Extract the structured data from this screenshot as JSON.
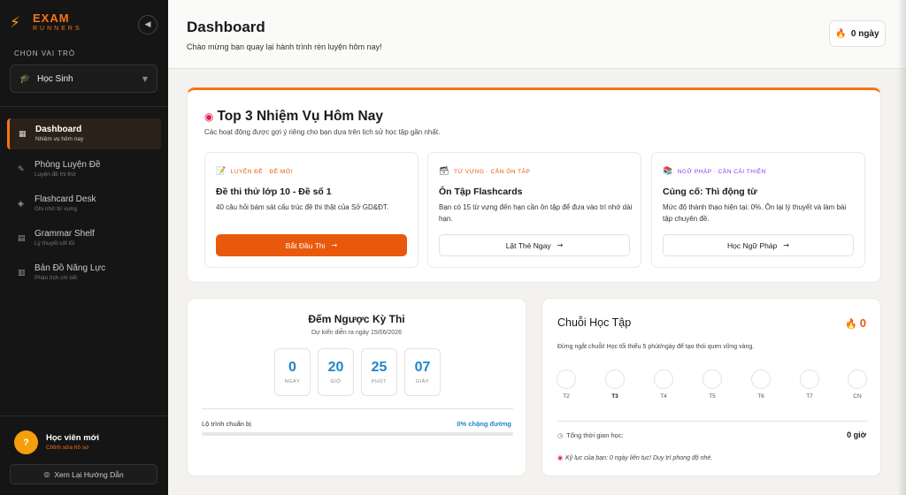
{
  "brand": {
    "name": "EXAM",
    "tagline": "RUNNERS"
  },
  "role": {
    "label": "CHỌN VAI TRÒ",
    "selected": "Học Sinh"
  },
  "nav": [
    {
      "title": "Dashboard",
      "sub": "Nhiệm vụ hôm nay"
    },
    {
      "title": "Phòng Luyện Đề",
      "sub": "Luyện đề thi thử"
    },
    {
      "title": "Flashcard Desk",
      "sub": "Ghi nhớ từ vựng"
    },
    {
      "title": "Grammar Shelf",
      "sub": "Lý thuyết cốt lõi"
    },
    {
      "title": "Bản Đồ Năng Lực",
      "sub": "Phân tích chi tiết"
    }
  ],
  "user": {
    "initial": "?",
    "name": "Học viên mới",
    "edit": "Chỉnh sửa hồ sơ"
  },
  "guide_button": "Xem Lại Hướng Dẫn",
  "header": {
    "title": "Dashboard",
    "subtitle": "Chào mừng bạn quay lại hành trình rèn luyện hôm nay!",
    "streak": "0 ngày"
  },
  "missions": {
    "title": "Top 3 Nhiệm Vụ Hôm Nay",
    "subtitle": "Các hoạt động được gợi ý riêng cho bạn dựa trên lịch sử học tập gần nhất.",
    "tasks": [
      {
        "tag": "LUYỆN ĐỀ · ĐỀ MỚI",
        "tag_color": "#ea580c",
        "icon": "memo-icon",
        "name": "Đề thi thử lớp 10 - Đề số 1",
        "desc": "40 câu hỏi bám sát cấu trúc đề thi thật của Sở GD&ĐT.",
        "button": "Bắt Đầu Thi"
      },
      {
        "tag": "TỪ VỰNG · CẦN ÔN TẬP",
        "tag_color": "#ea580c",
        "icon": "card-box-icon",
        "name": "Ôn Tập Flashcards",
        "desc": "Bạn có 15 từ vựng đến hạn cần ôn tập để đưa vào trí nhớ dài hạn.",
        "button": "Lật Thẻ Ngay"
      },
      {
        "tag": "NGỮ PHÁP · CẦN CẢI THIỆN",
        "tag_color": "#9333ea",
        "icon": "books-icon",
        "name": "Củng cố: Thì động từ",
        "desc": "Mức độ thành thạo hiện tại: 0%. Ôn lại lý thuyết và làm bài tập chuyên đề.",
        "button": "Học Ngữ Pháp"
      }
    ]
  },
  "countdown": {
    "title": "Đếm Ngược Kỳ Thi",
    "subtitle": "Dự kiến diễn ra ngày 15/06/2026",
    "units": [
      {
        "value": "0",
        "label": "NGÀY"
      },
      {
        "value": "20",
        "label": "GIỜ"
      },
      {
        "value": "25",
        "label": "PHÚT"
      },
      {
        "value": "07",
        "label": "GIÂY"
      }
    ],
    "progress_label": "Lộ trình chuẩn bị",
    "progress_text": "0% chặng đường",
    "progress_fraction": 0
  },
  "streak": {
    "title": "Chuỗi Học Tập",
    "count": "0",
    "subtitle": "Đừng ngắt chuỗi! Học tối thiểu 5 phút/ngày để tạo thói quen vững vàng.",
    "days": [
      {
        "label": "T2",
        "today": false
      },
      {
        "label": "T3",
        "today": true
      },
      {
        "label": "T4",
        "today": false
      },
      {
        "label": "T5",
        "today": false
      },
      {
        "label": "T6",
        "today": false
      },
      {
        "label": "T7",
        "today": false
      },
      {
        "label": "CN",
        "today": false
      }
    ],
    "total_label": "Tổng thời gian học:",
    "total_value": "0 giờ",
    "record": "Kỷ lục của bạn: 0 ngày liên tục! Duy trì phong độ nhé."
  }
}
